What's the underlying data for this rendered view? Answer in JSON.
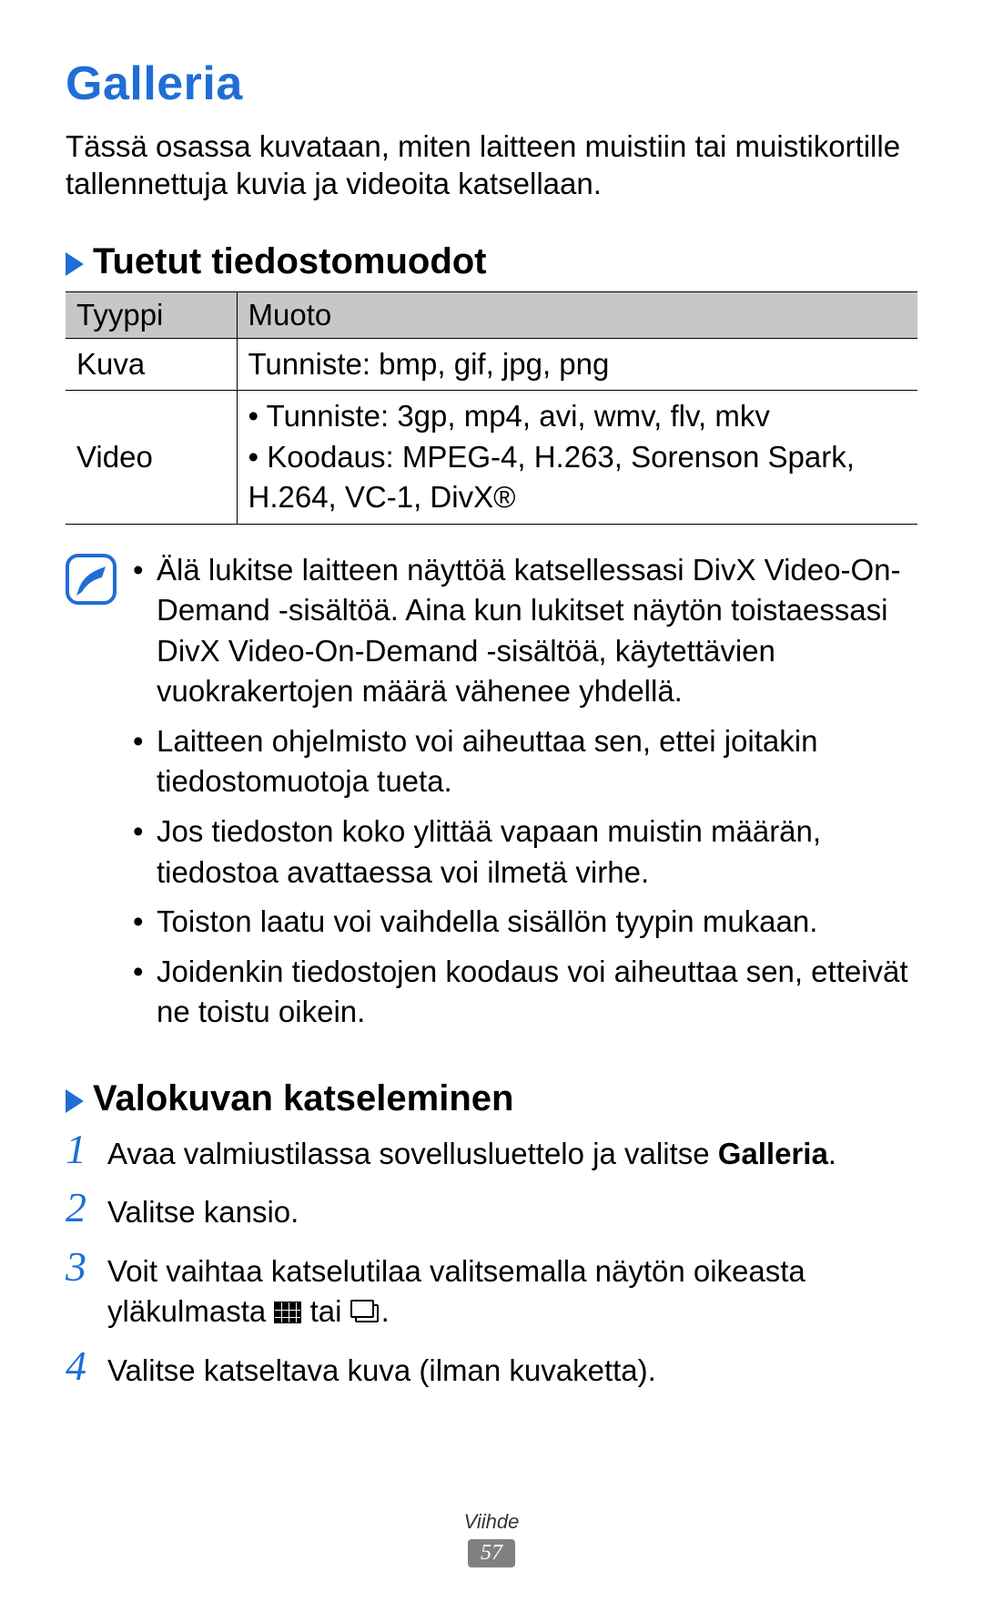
{
  "title": "Galleria",
  "intro": "Tässä osassa kuvataan, miten laitteen muistiin tai muistikortille tallennettuja kuvia ja videoita katsellaan.",
  "section1": {
    "heading": "Tuetut tiedostomuodot",
    "table": {
      "headers": [
        "Tyyppi",
        "Muoto"
      ],
      "rows": [
        {
          "type": "Kuva",
          "format_lines": [
            "Tunniste: bmp, gif, jpg, png"
          ]
        },
        {
          "type": "Video",
          "format_lines": [
            "Tunniste: 3gp, mp4, avi, wmv, flv, mkv",
            "Koodaus: MPEG-4, H.263, Sorenson Spark, H.264, VC-1, DivX®"
          ]
        }
      ]
    }
  },
  "notes": [
    "Älä lukitse laitteen näyttöä katsellessasi DivX Video-On-Demand -sisältöä. Aina kun lukitset näytön toistaessasi DivX Video-On-Demand -sisältöä, käytettävien vuokrakertojen määrä vähenee yhdellä.",
    "Laitteen ohjelmisto voi aiheuttaa sen, ettei joitakin tiedostomuotoja tueta.",
    "Jos tiedoston koko ylittää vapaan muistin määrän, tiedostoa avattaessa voi ilmetä virhe.",
    "Toiston laatu voi vaihdella sisällön tyypin mukaan.",
    "Joidenkin tiedostojen koodaus voi aiheuttaa sen, etteivät ne toistu oikein."
  ],
  "section2": {
    "heading": "Valokuvan katseleminen",
    "steps": [
      {
        "num": "1",
        "pre": "Avaa valmiustilassa sovellusluettelo ja valitse ",
        "bold": "Galleria",
        "post": "."
      },
      {
        "num": "2",
        "pre": "Valitse kansio.",
        "bold": "",
        "post": ""
      },
      {
        "num": "3",
        "pre": "Voit vaihtaa katselutilaa valitsemalla näytön oikeasta yläkulmasta ",
        "icons": true,
        "mid": " tai ",
        "post2": "."
      },
      {
        "num": "4",
        "pre": "Valitse katseltava kuva (ilman kuvaketta).",
        "bold": "",
        "post": ""
      }
    ]
  },
  "footer": {
    "section": "Viihde",
    "page": "57"
  }
}
